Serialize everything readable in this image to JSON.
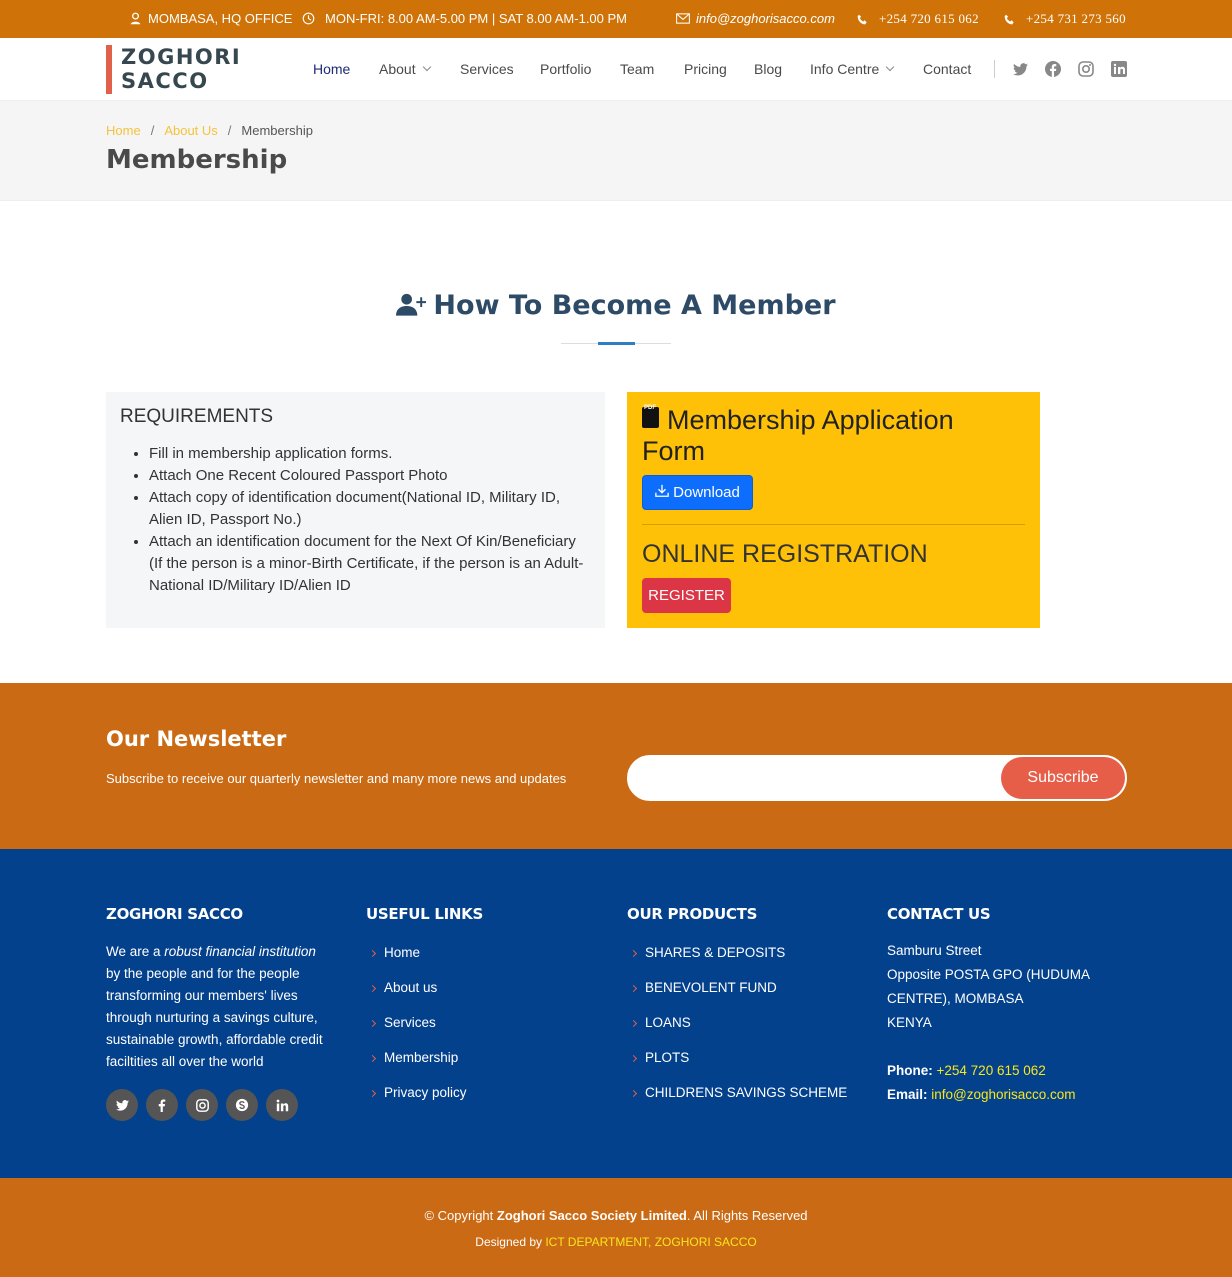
{
  "topbar": {
    "location": "MOMBASA, HQ OFFICE",
    "hours": "MON-FRI: 8.00 AM-5.00 PM | SAT 8.00 AM-1.00 PM",
    "email": "info@zoghorisacco.com",
    "phone1": "+254 720 615 062",
    "phone2": "+254 731 273 560"
  },
  "brand": {
    "line1": "ZOGHORI",
    "line2": "SACCO",
    "accent": "#e0604a"
  },
  "nav": {
    "home": "Home",
    "about": "About",
    "services": "Services",
    "portfolio": "Portfolio",
    "team": "Team",
    "pricing": "Pricing",
    "blog": "Blog",
    "info": "Info Centre",
    "contact": "Contact",
    "social_icons": [
      "twitter-icon",
      "facebook-icon",
      "instagram-icon",
      "linkedin-icon"
    ]
  },
  "breadcrumb": {
    "home": "Home",
    "about": "About Us",
    "current": "Membership"
  },
  "page_title": "Membership",
  "section_title": "How To Become A Member",
  "requirements": {
    "title": "REQUIREMENTS",
    "items": [
      "Fill in membership application forms.",
      "Attach One Recent Coloured Passport Photo",
      "Attach copy of identification document(National ID, Military ID, Alien ID, Passport No.)",
      "Attach an identification document for the Next Of Kin/Beneficiary (If the person is a minor-Birth Certificate, if the person is an Adult-National ID/Military ID/Alien ID"
    ]
  },
  "application": {
    "title": "Membership Application Form",
    "pdf_label": "PDF",
    "download_label": "Download",
    "online_title": "ONLINE REGISTRATION",
    "register_label": "REGISTER"
  },
  "newsletter": {
    "title": "Our Newsletter",
    "text": "Subscribe to receive our quarterly newsletter and many more news and updates",
    "input_value": "",
    "button": "Subscribe"
  },
  "footer": {
    "about_title": "ZOGHORI SACCO",
    "about_pre": "We are a ",
    "about_em": "robust financial institution",
    "about_post": " by the people and for the people transforming our members' lives through nurturing a savings culture, sustainable growth, affordable credit faciltities all over the world",
    "links_title": "USEFUL LINKS",
    "links": [
      "Home",
      "About us",
      "Services",
      "Membership",
      "Privacy policy"
    ],
    "products_title": "OUR PRODUCTS",
    "products": [
      "SHARES & DEPOSITS",
      "BENEVOLENT FUND",
      "LOANS",
      "PLOTS",
      "CHILDRENS SAVINGS SCHEME"
    ],
    "contact_title": "CONTACT US",
    "address": [
      "Samburu Street",
      "Opposite POSTA GPO (HUDUMA",
      "CENTRE), MOMBASA",
      "KENYA"
    ],
    "phone_label": "Phone:",
    "phone": "+254 720 615 062",
    "email_label": "Email:",
    "email": "info@zoghorisacco.com"
  },
  "bottom": {
    "copyright_pre": "© Copyright ",
    "company": "Zoghori Sacco Society Limited",
    "copyright_post": ". All Rights Reserved",
    "designed_pre": "Designed by ",
    "designer": "ICT DEPARTMENT, ZOGHORI SACCO"
  },
  "colors": {
    "topbar": "#cf7308",
    "footer": "#04418c",
    "newsletter": "#cb6a14",
    "form_box": "#ffc107"
  }
}
